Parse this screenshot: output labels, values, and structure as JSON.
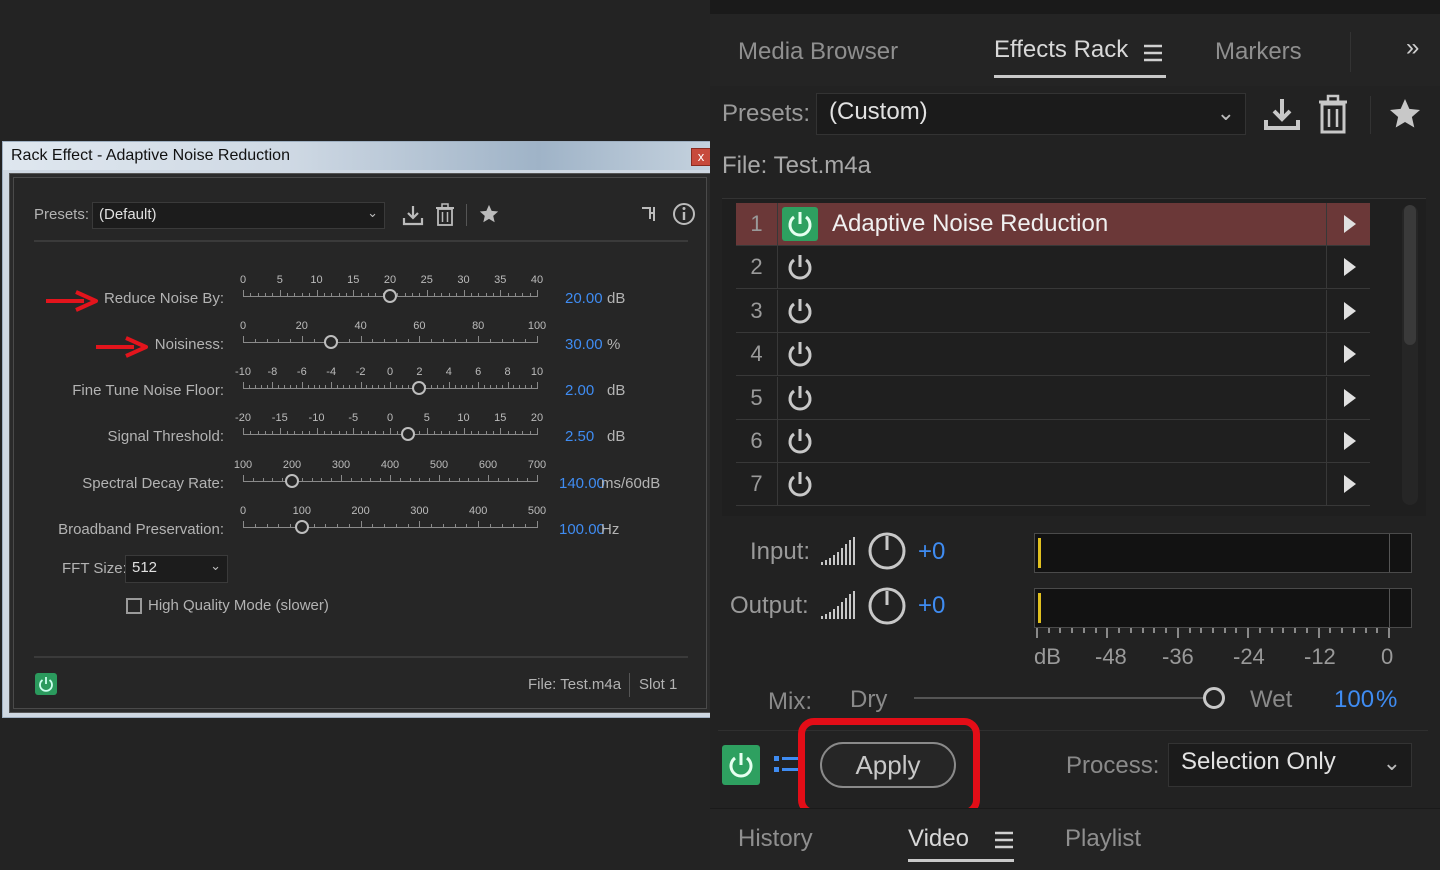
{
  "dialog": {
    "title": "Rack Effect - Adaptive Noise Reduction",
    "close": "x",
    "presets_label": "Presets:",
    "preset_value": "(Default)",
    "params": [
      {
        "label": "Reduce Noise By:",
        "ticks": [
          "0",
          "5",
          "10",
          "15",
          "20",
          "25",
          "30",
          "35",
          "40"
        ],
        "value": "20.00",
        "unit": "dB",
        "level": 0.5
      },
      {
        "label": "Noisiness:",
        "ticks": [
          "0",
          "20",
          "40",
          "60",
          "80",
          "100"
        ],
        "value": "30.00",
        "unit": "%",
        "level": 0.3
      },
      {
        "label": "Fine Tune Noise Floor:",
        "ticks": [
          "-10",
          "-8",
          "-6",
          "-4",
          "-2",
          "0",
          "2",
          "4",
          "6",
          "8",
          "10"
        ],
        "value": "2.00",
        "unit": "dB",
        "level": 0.6
      },
      {
        "label": "Signal Threshold:",
        "ticks": [
          "-20",
          "-15",
          "-10",
          "-5",
          "0",
          "5",
          "10",
          "15",
          "20"
        ],
        "value": "2.50",
        "unit": "dB",
        "level": 0.5625
      },
      {
        "label": "Spectral Decay Rate:",
        "ticks": [
          "100",
          "200",
          "300",
          "400",
          "500",
          "600",
          "700"
        ],
        "value": "140.00",
        "unit": "ms/60dB",
        "level": 0.165
      },
      {
        "label": "Broadband Preservation:",
        "ticks": [
          "0",
          "100",
          "200",
          "300",
          "400",
          "500"
        ],
        "value": "100.00",
        "unit": "Hz",
        "level": 0.2
      }
    ],
    "fft_label": "FFT Size:",
    "fft_value": "512",
    "hq_label": "High Quality Mode (slower)",
    "file_label": "File: Test.m4a",
    "slot_label": "Slot 1"
  },
  "rack": {
    "tabs": [
      "Media Browser",
      "Effects Rack",
      "Markers"
    ],
    "presets_label": "Presets:",
    "preset_value": "(Custom)",
    "file_label": "File: Test.m4a",
    "slots": [
      {
        "num": "1",
        "name": "Adaptive Noise Reduction",
        "on": true
      },
      {
        "num": "2",
        "name": "",
        "on": false
      },
      {
        "num": "3",
        "name": "",
        "on": false
      },
      {
        "num": "4",
        "name": "",
        "on": false
      },
      {
        "num": "5",
        "name": "",
        "on": false
      },
      {
        "num": "6",
        "name": "",
        "on": false
      },
      {
        "num": "7",
        "name": "",
        "on": false
      }
    ],
    "input_label": "Input:",
    "input_value": "+0",
    "output_label": "Output:",
    "output_value": "+0",
    "db_scale": [
      "dB",
      "-48",
      "-36",
      "-24",
      "-12",
      "0"
    ],
    "mix_label": "Mix:",
    "dry_label": "Dry",
    "wet_label": "Wet",
    "mix_value": "100",
    "mix_unit": "%",
    "mix_level": 1.0,
    "apply_label": "Apply",
    "process_label": "Process:",
    "process_value": "Selection Only",
    "bottom_tabs": [
      "History",
      "Video",
      "Playlist"
    ]
  },
  "colors": {
    "accent": "#3f8cf2",
    "power_on": "#2ea060",
    "selected_row": "#6b3838",
    "highlight": "#e30d17",
    "arrow": "#e3141c"
  }
}
